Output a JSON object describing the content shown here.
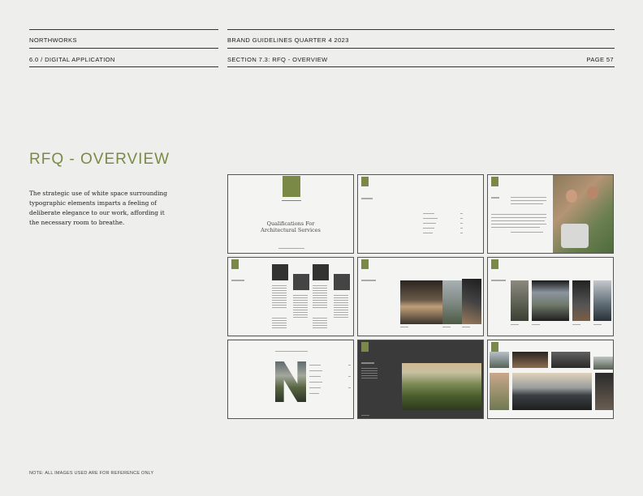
{
  "header": {
    "brand": "NORTHWORKS",
    "doc_title": "BRAND GUIDELINES QUARTER 4 2023",
    "chapter": "6.0 / DIGITAL APPLICATION",
    "section": "SECTION 7.3: RFQ - OVERVIEW",
    "page": "PAGE 57"
  },
  "main": {
    "title": "RFQ - OVERVIEW",
    "body": "The strategic use of white space surrounding typographic elements imparts a feeling of deliberate elegance to our work, affording it the necessary room to breathe."
  },
  "thumbnails": {
    "cover_line1": "Qualifications For",
    "cover_line2": "Architectural Services"
  },
  "footer": {
    "note": "NOTE: ALL IMAGES USED ARE FOR REFERENCE ONLY"
  },
  "colors": {
    "accent": "#7a8a46",
    "background": "#eeeeec"
  }
}
